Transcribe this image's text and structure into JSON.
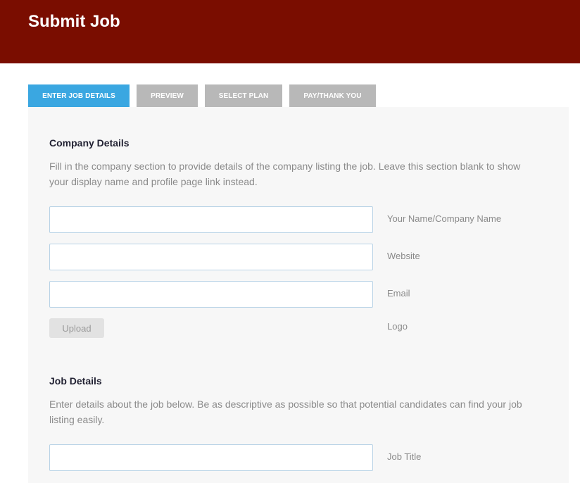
{
  "header": {
    "title": "Submit Job",
    "color": "#7a0d00"
  },
  "tabs": [
    {
      "label": "Enter Job Details",
      "active": true
    },
    {
      "label": "Preview",
      "active": false
    },
    {
      "label": "Select Plan",
      "active": false
    },
    {
      "label": "Pay/Thank You",
      "active": false
    }
  ],
  "company": {
    "title": "Company Details",
    "description": "Fill in the company section to provide details of the company listing the job. Leave this section blank to show your display name and profile page link instead.",
    "fields": [
      {
        "label": "Your Name/Company Name",
        "value": ""
      },
      {
        "label": "Website",
        "value": ""
      },
      {
        "label": "Email",
        "value": ""
      }
    ],
    "upload_label": "Upload",
    "logo_label": "Logo"
  },
  "job": {
    "title": "Job Details",
    "description": "Enter details about the job below. Be as descriptive as possible so that potential candidates can find your job listing easily.",
    "fields": [
      {
        "label": "Job Title",
        "value": ""
      }
    ]
  },
  "colors": {
    "accent": "#3aa7e1",
    "tab_inactive": "#b8b8b8",
    "panel_bg": "#f7f7f7"
  }
}
